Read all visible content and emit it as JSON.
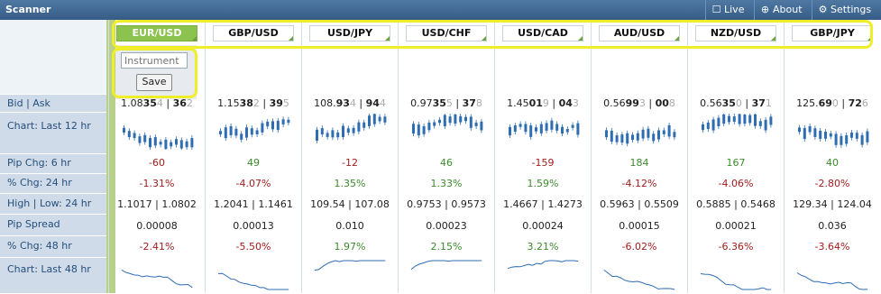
{
  "app": {
    "title": "Scanner"
  },
  "toolbar": {
    "live_label": "Live",
    "about_label": "About",
    "settings_label": "Settings"
  },
  "editor": {
    "instrument_placeholder": "Instrument",
    "save_label": "Save"
  },
  "rows": {
    "bid_ask": "Bid | Ask",
    "chart_12": "Chart: Last 12 hr",
    "pip_chg_6": "Pip Chg: 6 hr",
    "pct_chg_24": "% Chg: 24 hr",
    "high_low_24": "High | Low: 24 hr",
    "pip_spread": "Pip Spread",
    "pct_chg_48": "% Chg: 48 hr",
    "chart_48": "Chart: Last 48 hr"
  },
  "instruments": [
    {
      "pair": "EUR/USD",
      "bid_a": "1.08",
      "bid_b": "35",
      "bid_c": "4",
      "sep": " | ",
      "ask_b": "36",
      "ask_c": "2",
      "pip6": "-60",
      "pct24": "-1.31%",
      "hl": "1.1017 | 1.0802",
      "spread": "0.00008",
      "pct48": "-2.41%"
    },
    {
      "pair": "GBP/USD",
      "bid_a": "1.15",
      "bid_b": "38",
      "bid_c": "2",
      "sep": " | ",
      "ask_b": "39",
      "ask_c": "5",
      "pip6": "49",
      "pct24": "-4.07%",
      "hl": "1.2041 | 1.1461",
      "spread": "0.00013",
      "pct48": "-5.50%"
    },
    {
      "pair": "USD/JPY",
      "bid_a": "108.",
      "bid_b": "93",
      "bid_c": "4",
      "sep": " | ",
      "ask_b": "94",
      "ask_c": "4",
      "pip6": "-12",
      "pct24": "1.35%",
      "hl": "109.54 | 107.08",
      "spread": "0.010",
      "pct48": "1.97%"
    },
    {
      "pair": "USD/CHF",
      "bid_a": "0.97",
      "bid_b": "35",
      "bid_c": "5",
      "sep": " | ",
      "ask_b": "37",
      "ask_c": "8",
      "pip6": "46",
      "pct24": "1.33%",
      "hl": "0.9753 | 0.9573",
      "spread": "0.00023",
      "pct48": "2.15%"
    },
    {
      "pair": "USD/CAD",
      "bid_a": "1.45",
      "bid_b": "01",
      "bid_c": "9",
      "sep": " | ",
      "ask_b": "04",
      "ask_c": "3",
      "pip6": "-159",
      "pct24": "1.59%",
      "hl": "1.4667 | 1.4273",
      "spread": "0.00024",
      "pct48": "3.21%"
    },
    {
      "pair": "AUD/USD",
      "bid_a": "0.56",
      "bid_b": "99",
      "bid_c": "3",
      "sep": " | ",
      "ask_b": "00",
      "ask_c": "8",
      "pip6": "184",
      "pct24": "-4.12%",
      "hl": "0.5963 | 0.5509",
      "spread": "0.00015",
      "pct48": "-6.02%"
    },
    {
      "pair": "NZD/USD",
      "bid_a": "0.56",
      "bid_b": "35",
      "bid_c": "0",
      "sep": " | ",
      "ask_b": "37",
      "ask_c": "1",
      "pip6": "167",
      "pct24": "-4.06%",
      "hl": "0.5885 | 0.5468",
      "spread": "0.00021",
      "pct48": "-6.36%"
    },
    {
      "pair": "GBP/JPY",
      "bid_a": "125.",
      "bid_b": "69",
      "bid_c": "0",
      "sep": " | ",
      "ask_b": "72",
      "ask_c": "6",
      "pip6": "40",
      "pct24": "-2.80%",
      "hl": "129.34 | 124.04",
      "spread": "0.036",
      "pct48": "-3.64%"
    }
  ],
  "colors": {
    "header": "#355c86",
    "accent": "#8cc34f",
    "highlight": "#f0ee2a",
    "negative": "#a21c1c",
    "positive": "#3b8a2b",
    "candle": "#2f6db3"
  },
  "icons": {
    "live": "checkbox-icon",
    "about": "globe-icon",
    "settings": "gear-icon"
  }
}
